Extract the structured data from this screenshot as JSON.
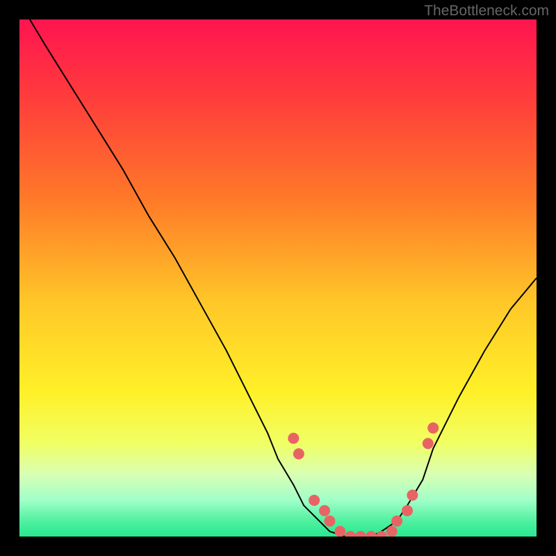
{
  "watermark": "TheBottleneck.com",
  "chart_data": {
    "type": "line",
    "title": "",
    "xlabel": "",
    "ylabel": "",
    "xlim": [
      0,
      100
    ],
    "ylim": [
      0,
      100
    ],
    "series": [
      {
        "name": "bottleneck-curve",
        "x": [
          2,
          5,
          10,
          15,
          20,
          25,
          30,
          35,
          40,
          45,
          48,
          50,
          53,
          55,
          58,
          60,
          63,
          65,
          68,
          70,
          73,
          75,
          78,
          80,
          85,
          90,
          95,
          100
        ],
        "y": [
          100,
          95,
          87,
          79,
          71,
          62,
          54,
          45,
          36,
          26,
          20,
          15,
          10,
          6,
          3,
          1,
          0,
          0,
          0,
          1,
          3,
          6,
          11,
          17,
          27,
          36,
          44,
          50
        ]
      }
    ],
    "markers": {
      "name": "data-points",
      "x": [
        53,
        54,
        57,
        59,
        60,
        62,
        64,
        66,
        68,
        70,
        72,
        73,
        75,
        76,
        79,
        80
      ],
      "y": [
        19,
        16,
        7,
        5,
        3,
        1,
        0,
        0,
        0,
        0,
        1,
        3,
        5,
        8,
        18,
        21
      ]
    },
    "gradient": {
      "stops": [
        {
          "pos": 0,
          "color": "#ff1450"
        },
        {
          "pos": 15,
          "color": "#ff3c3c"
        },
        {
          "pos": 35,
          "color": "#ff7a28"
        },
        {
          "pos": 55,
          "color": "#ffc828"
        },
        {
          "pos": 72,
          "color": "#fff028"
        },
        {
          "pos": 82,
          "color": "#f0ff64"
        },
        {
          "pos": 88,
          "color": "#d8ffb4"
        },
        {
          "pos": 93,
          "color": "#a0ffc8"
        },
        {
          "pos": 97,
          "color": "#50f0a0"
        },
        {
          "pos": 100,
          "color": "#28e890"
        }
      ]
    },
    "marker_color": "#e86464"
  }
}
